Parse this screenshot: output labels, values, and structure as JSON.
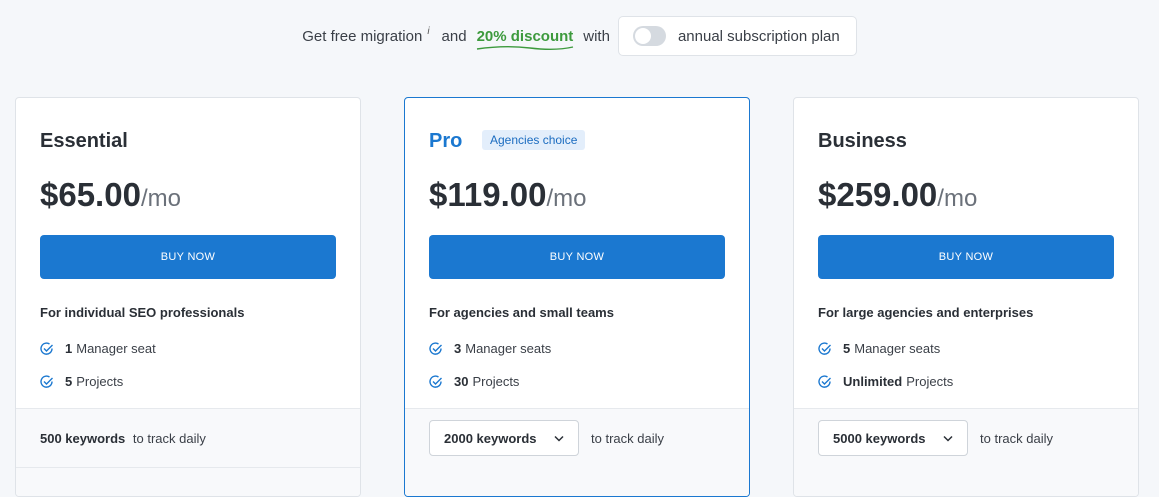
{
  "promo": {
    "prefix": "Get free migration",
    "info_marker": "i",
    "and": "and",
    "discount": "20% discount",
    "with": "with",
    "toggle_label": "annual subscription plan",
    "toggle_on": false
  },
  "colors": {
    "accent": "#1b78d0",
    "discount_green": "#3d9a3d",
    "check_blue": "#1b78d0"
  },
  "plans": [
    {
      "name": "Essential",
      "badge": "",
      "price": "$65.00",
      "per": "/mo",
      "buy_label": "BUY NOW",
      "audience": "For individual SEO professionals",
      "features": [
        {
          "bold": "1",
          "text": "Manager seat"
        },
        {
          "bold": "5",
          "text": "Projects"
        }
      ],
      "keywords_value": "500 keywords",
      "keywords_suffix": "to track daily"
    },
    {
      "name": "Pro",
      "badge": "Agencies choice",
      "price": "$119.00",
      "per": "/mo",
      "buy_label": "BUY NOW",
      "audience": "For agencies and small teams",
      "features": [
        {
          "bold": "3",
          "text": "Manager seats"
        },
        {
          "bold": "30",
          "text": "Projects"
        }
      ],
      "keywords_value": "2000 keywords",
      "keywords_suffix": "to track daily"
    },
    {
      "name": "Business",
      "badge": "",
      "price": "$259.00",
      "per": "/mo",
      "buy_label": "BUY NOW",
      "audience": "For large agencies and enterprises",
      "features": [
        {
          "bold": "5",
          "text": "Manager seats"
        },
        {
          "bold": "Unlimited",
          "text": "Projects"
        }
      ],
      "keywords_value": "5000 keywords",
      "keywords_suffix": "to track daily"
    }
  ]
}
